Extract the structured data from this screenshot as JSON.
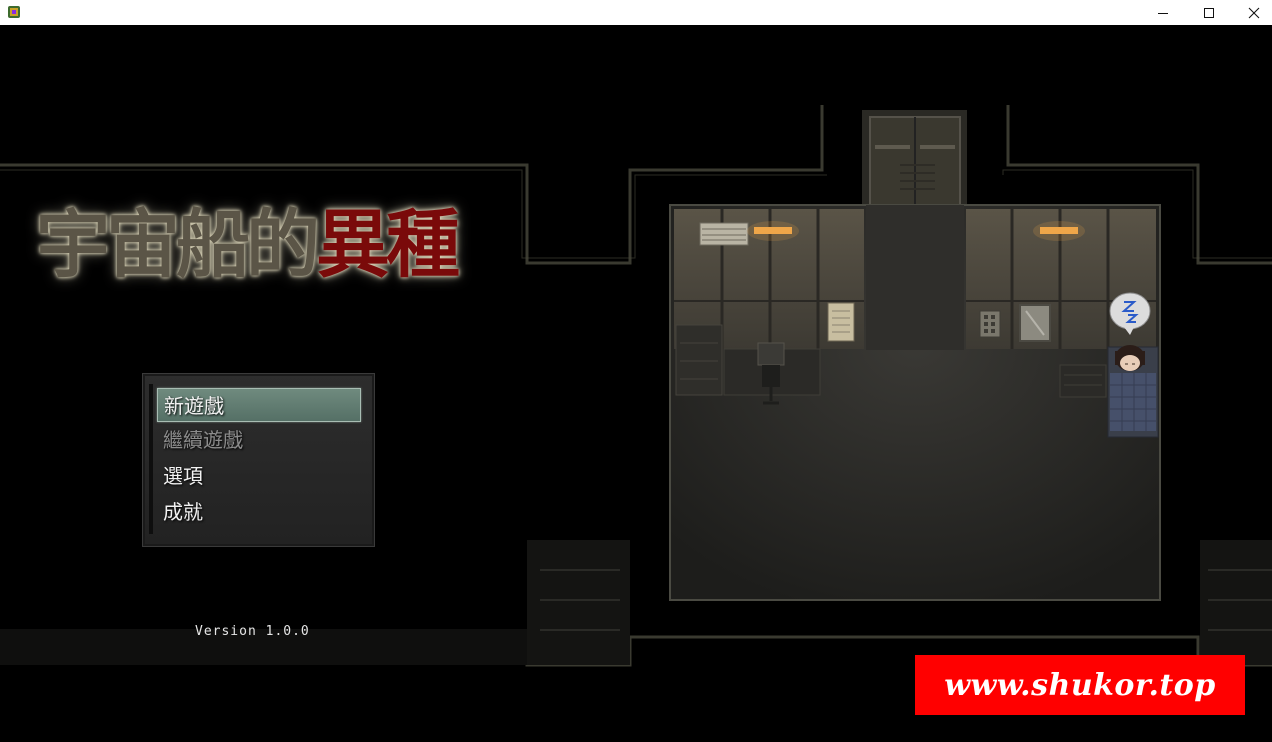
{
  "window": {
    "icons": {
      "app": "rpg-maker-icon",
      "minimize": "minimize-icon",
      "maximize": "maximize-icon",
      "close": "close-icon"
    }
  },
  "game": {
    "logo": {
      "part_a": "宇宙船的",
      "part_b": "異種"
    },
    "menu": {
      "items": [
        {
          "label": "新遊戲",
          "state": "selected"
        },
        {
          "label": "繼續遊戲",
          "state": "disabled"
        },
        {
          "label": "選項",
          "state": "normal"
        },
        {
          "label": "成就",
          "state": "normal"
        }
      ]
    },
    "version": "Version 1.0.0",
    "character_status": "sleeping",
    "sleep_bubble_icon": "zzz-icon"
  },
  "watermark": {
    "text": "www.shukor.top",
    "color": "#ff0000"
  },
  "colors": {
    "menu_selected": "#6a8478",
    "logo_red": "#7a0a0a"
  }
}
